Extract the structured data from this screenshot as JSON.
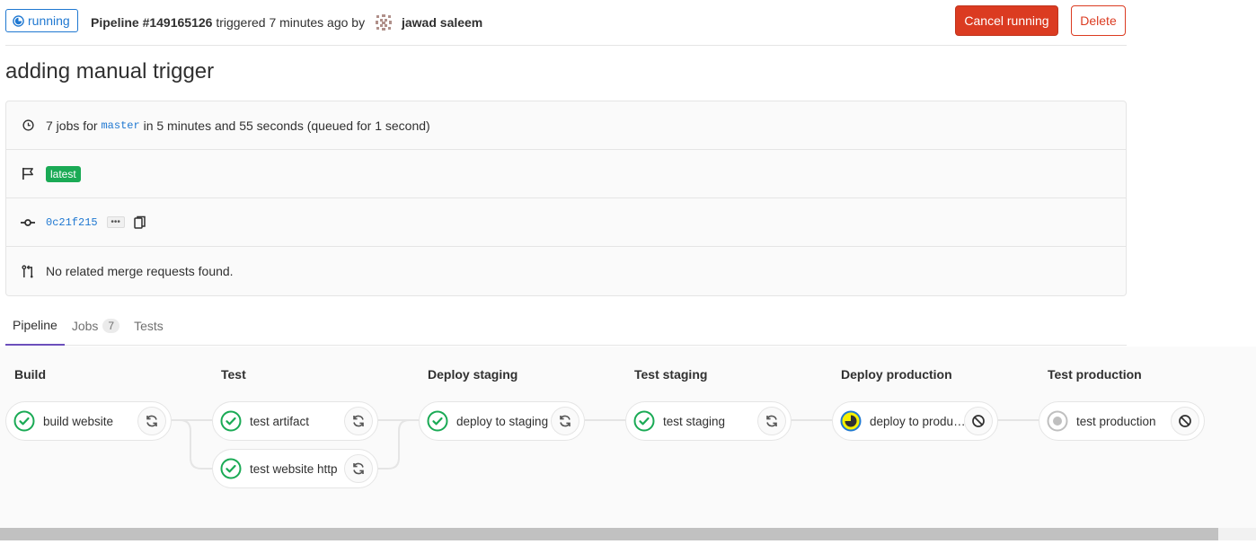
{
  "header": {
    "status": "running",
    "pipeline_label": "Pipeline #149165126",
    "triggered_text": " triggered 7 minutes ago by ",
    "author": "jawad saleem",
    "cancel_button": "Cancel running",
    "delete_button": "Delete",
    "colors": {
      "running": "#1f78d1",
      "danger": "#db3b21",
      "success": "#1aaa55"
    }
  },
  "title": "adding manual trigger",
  "info": {
    "jobs_prefix": "7 jobs for ",
    "branch": "master",
    "jobs_suffix": " in 5 minutes and 55 seconds (queued for 1 second)",
    "tag": "latest",
    "commit": "0c21f215",
    "ellipsis": "•••",
    "merge_requests": "No related merge requests found.",
    "icons": [
      "clock-icon",
      "flag-icon",
      "commit-icon",
      "merge-request-icon",
      "copy-icon"
    ]
  },
  "tabs": {
    "pipeline": "Pipeline",
    "jobs": "Jobs",
    "jobs_count": "7",
    "tests": "Tests"
  },
  "stages": [
    {
      "name": "Build",
      "jobs": [
        {
          "name": "build website",
          "status": "passed",
          "action": "retry"
        }
      ]
    },
    {
      "name": "Test",
      "jobs": [
        {
          "name": "test artifact",
          "status": "passed",
          "action": "retry"
        },
        {
          "name": "test website http",
          "status": "passed",
          "action": "retry"
        }
      ]
    },
    {
      "name": "Deploy staging",
      "jobs": [
        {
          "name": "deploy to staging",
          "status": "passed",
          "action": "retry"
        }
      ]
    },
    {
      "name": "Test staging",
      "jobs": [
        {
          "name": "test staging",
          "status": "passed",
          "action": "retry"
        }
      ]
    },
    {
      "name": "Deploy production",
      "jobs": [
        {
          "name": "deploy to production",
          "status": "running",
          "action": "cancel"
        }
      ]
    },
    {
      "name": "Test production",
      "jobs": [
        {
          "name": "test production",
          "status": "created",
          "action": "cancel"
        }
      ]
    }
  ]
}
